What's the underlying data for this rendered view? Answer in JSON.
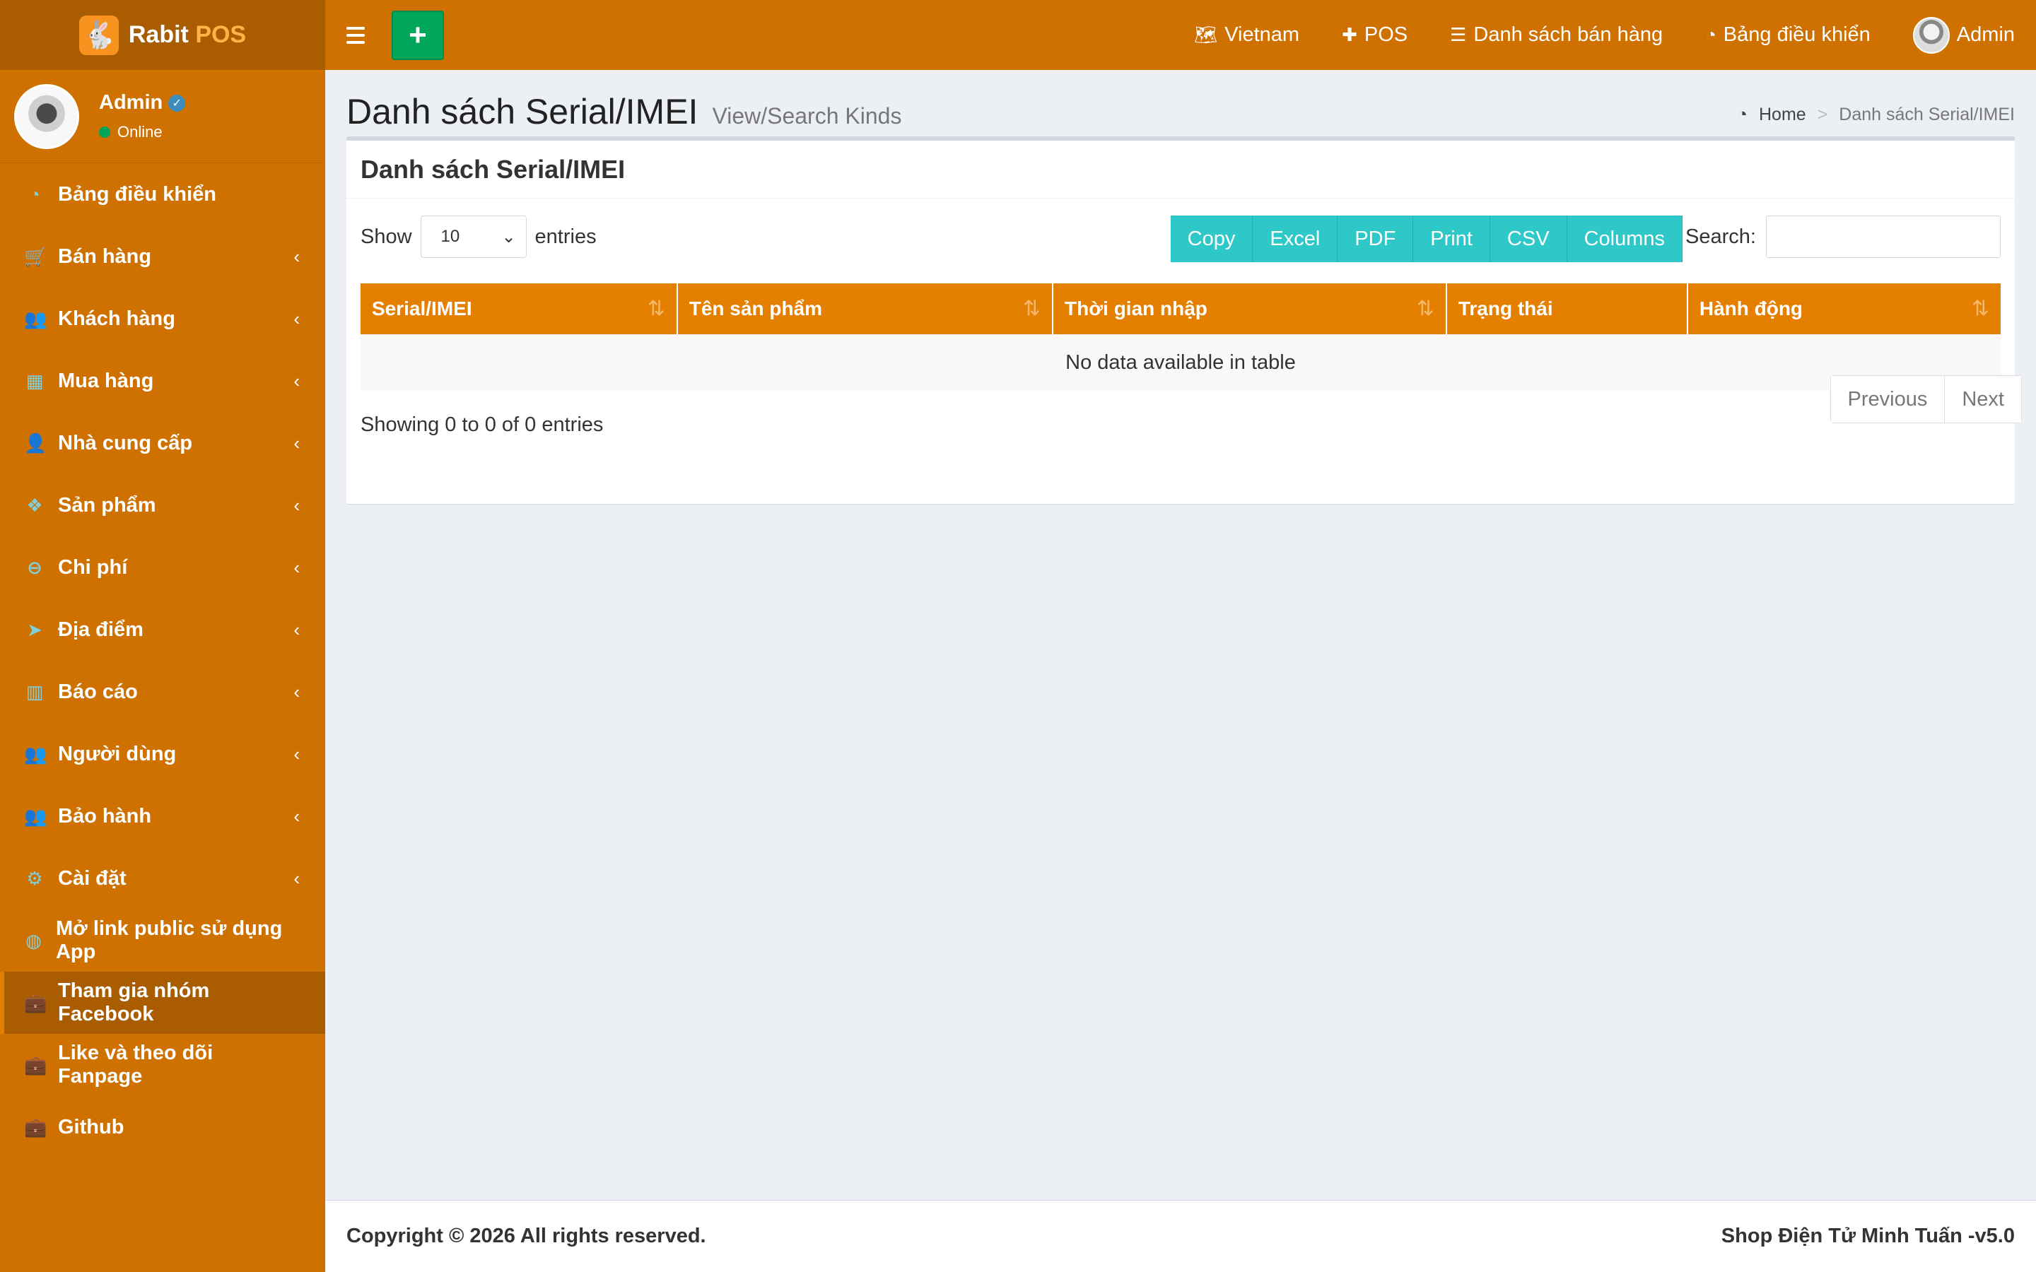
{
  "logo": {
    "name": "Rabit",
    "accent": "POS"
  },
  "topnav": {
    "items": [
      {
        "icon": "🗺",
        "label": "Vietnam"
      },
      {
        "icon": "✚",
        "label": "POS"
      },
      {
        "icon": "☰",
        "label": "Danh sách bán hàng"
      },
      {
        "icon": "◔",
        "label": "Bảng điều khiển"
      }
    ],
    "user": "Admin"
  },
  "user_panel": {
    "name": "Admin",
    "status": "Online"
  },
  "sidebar": {
    "items": [
      {
        "icon": "◔",
        "label": "Bảng điều khiển",
        "chev": ""
      },
      {
        "icon": "🛒",
        "label": "Bán hàng",
        "chev": "‹"
      },
      {
        "icon": "👥",
        "label": "Khách hàng",
        "chev": "‹"
      },
      {
        "icon": "▦",
        "label": "Mua hàng",
        "chev": "‹"
      },
      {
        "icon": "👤",
        "label": "Nhà cung cấp",
        "chev": "‹"
      },
      {
        "icon": "❖",
        "label": "Sản phẩm",
        "chev": "‹"
      },
      {
        "icon": "⊖",
        "label": "Chi phí",
        "chev": "‹"
      },
      {
        "icon": "➤",
        "label": "Địa điểm",
        "chev": "‹"
      },
      {
        "icon": "▥",
        "label": "Báo cáo",
        "chev": "‹"
      },
      {
        "icon": "👥",
        "label": "Người dùng",
        "chev": "‹"
      },
      {
        "icon": "👥",
        "label": "Bảo hành",
        "chev": "‹"
      },
      {
        "icon": "⚙",
        "label": "Cài đặt",
        "chev": "‹"
      },
      {
        "icon": "◍",
        "label": "Mở link public sử dụng App",
        "chev": ""
      },
      {
        "icon": "💼",
        "label": "Tham gia nhóm Facebook",
        "chev": ""
      },
      {
        "icon": "💼",
        "label": "Like và theo dõi Fanpage",
        "chev": ""
      },
      {
        "icon": "💼",
        "label": "Github",
        "chev": ""
      }
    ]
  },
  "header": {
    "title": "Danh sách Serial/IMEI",
    "subtitle": "View/Search Kinds"
  },
  "breadcrumb": {
    "home": "Home",
    "sep": ">",
    "current": "Danh sách Serial/IMEI"
  },
  "box": {
    "title": "Danh sách Serial/IMEI"
  },
  "table_controls": {
    "show_label": "Show",
    "entries_label": "entries",
    "page_length": "10",
    "buttons": [
      "Copy",
      "Excel",
      "PDF",
      "Print",
      "CSV",
      "Columns"
    ],
    "search_label": "Search:"
  },
  "table": {
    "columns": [
      {
        "label": "Serial/IMEI",
        "sortable": true
      },
      {
        "label": "Tên sản phẩm",
        "sortable": true
      },
      {
        "label": "Thời gian nhập",
        "sortable": true
      },
      {
        "label": "Trạng thái",
        "sortable": false
      },
      {
        "label": "Hành động",
        "sortable": true
      }
    ],
    "empty_message": "No data available in table",
    "info": "Showing 0 to 0 of 0 entries"
  },
  "pagination": {
    "previous": "Previous",
    "next": "Next"
  },
  "footer": {
    "copyright": "Copyright © 2026 All rights reserved.",
    "version": "Shop Điện Tử Minh Tuấn -v5.0"
  },
  "colors": {
    "header": "#cf7100",
    "logo_bg": "#a95d00",
    "table_head": "#e47f00",
    "buttons": "#2ec8c8",
    "add_button": "#00a65a"
  }
}
